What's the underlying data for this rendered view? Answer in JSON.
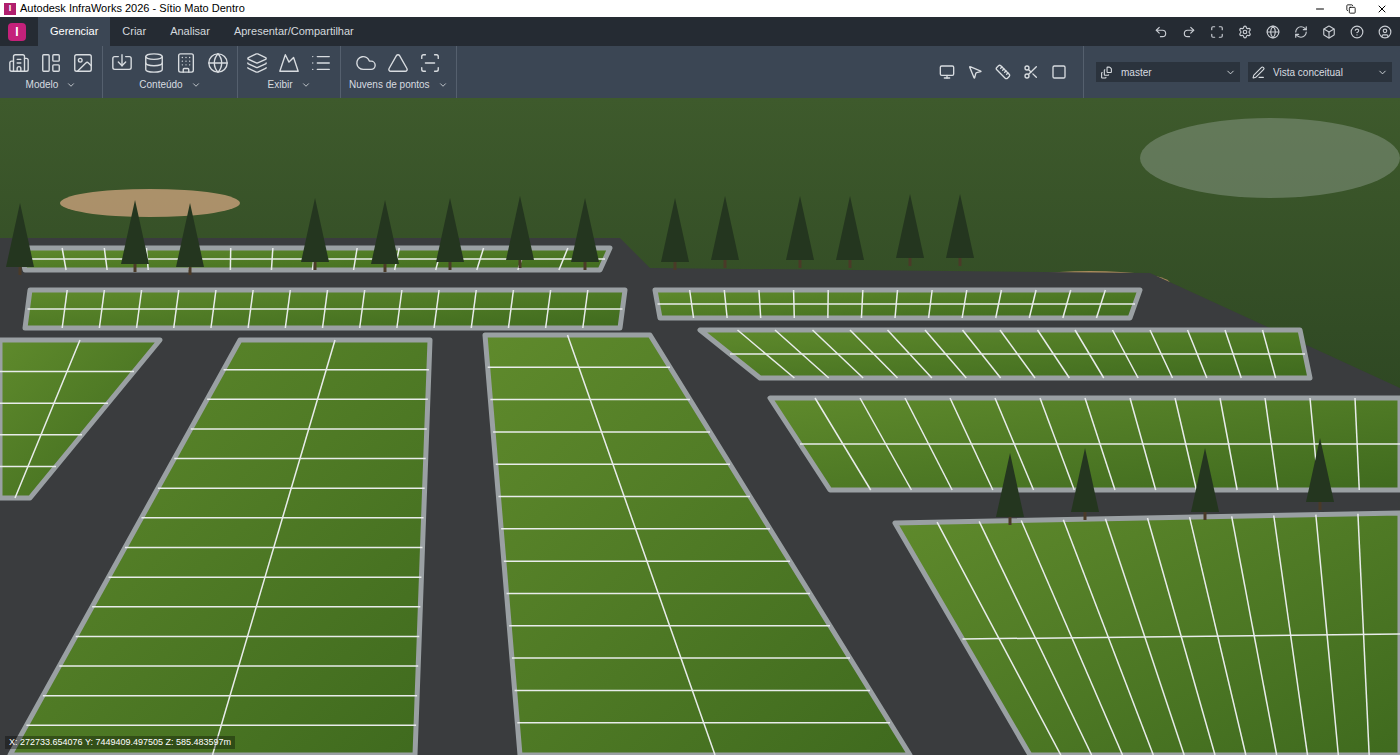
{
  "window": {
    "title": "Autodesk InfraWorks 2026 - Sítio Mato Dentro",
    "logo": "I"
  },
  "app_button": {
    "logo": "I"
  },
  "tabs": [
    {
      "label": "Gerenciar",
      "selected": true
    },
    {
      "label": "Criar",
      "selected": false
    },
    {
      "label": "Analisar",
      "selected": false
    },
    {
      "label": "Apresentar/Compartilhar",
      "selected": false
    }
  ],
  "ribbon_groups": [
    {
      "label": "Modelo"
    },
    {
      "label": "Conteúdo"
    },
    {
      "label": "Exibir"
    },
    {
      "label": "Nuvens de pontos"
    }
  ],
  "proposal": {
    "value": "master"
  },
  "visual_style": {
    "value": "Vista conceitual"
  },
  "coordinates": "X: 272733.654076 Y: 7449409.497505 Z: 585.483597m"
}
